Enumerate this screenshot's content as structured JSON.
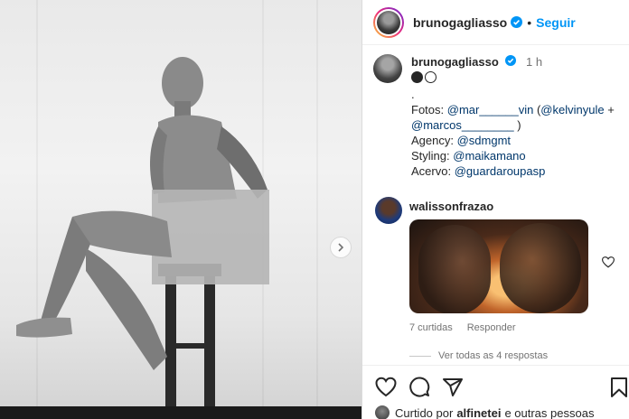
{
  "post": {
    "next_icon": "chevron-right-icon"
  },
  "header": {
    "username": "brunogagliasso",
    "separator": "•",
    "follow_label": "Seguir"
  },
  "caption": {
    "username": "brunogagliasso",
    "time": "1 h",
    "line_dot": ".",
    "photos_prefix": "Fotos: ",
    "photos_mention1": "@mar______vin",
    "photos_open": " (",
    "photos_mention2": "@kelvinyule",
    "photos_plus": " +",
    "photos_mention3": "@marcos________",
    "photos_close": " )",
    "agency_label": "Agency: ",
    "agency_mention": "@sdmgmt",
    "styling_label": "Styling: ",
    "styling_mention": "@maikamano",
    "acervo_label": "Acervo: ",
    "acervo_mention": "@guardaroupasp"
  },
  "comment": {
    "username": "walissonfrazao",
    "likes": "7 curtidas",
    "reply_label": "Responder",
    "view_replies": "Ver todas as 4 respostas"
  },
  "footer": {
    "liked_prefix": "Curtido por",
    "liked_user": "alfinetei",
    "liked_suffix": "e outras pessoas"
  },
  "colors": {
    "accent": "#0095f6",
    "mention": "#00376b",
    "text": "#262626",
    "muted": "#737373",
    "verified": "#0095f6"
  }
}
